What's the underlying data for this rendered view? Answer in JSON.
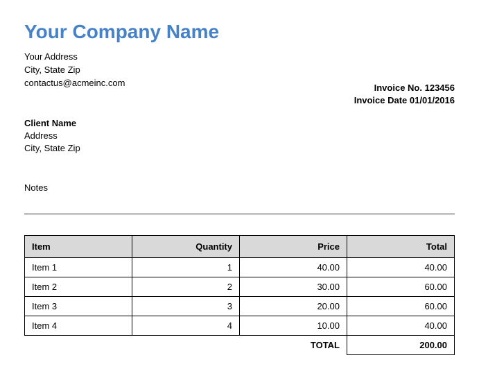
{
  "company": {
    "name": "Your Company Name",
    "address_line1": "Your Address",
    "address_line2": "City, State Zip",
    "email": "contactus@acmeinc.com"
  },
  "invoice": {
    "number_label": "Invoice No.",
    "number": "123456",
    "date_label": "Invoice Date",
    "date": "01/01/2016"
  },
  "client": {
    "name": "Client Name",
    "address_line1": "Address",
    "address_line2": "City, State Zip"
  },
  "notes_label": "Notes",
  "table": {
    "headers": {
      "item": "Item",
      "quantity": "Quantity",
      "price": "Price",
      "total": "Total"
    },
    "rows": [
      {
        "item": "Item 1",
        "quantity": "1",
        "price": "40.00",
        "total": "40.00"
      },
      {
        "item": "Item 2",
        "quantity": "2",
        "price": "30.00",
        "total": "60.00"
      },
      {
        "item": "Item 3",
        "quantity": "3",
        "price": "20.00",
        "total": "60.00"
      },
      {
        "item": "Item 4",
        "quantity": "4",
        "price": "10.00",
        "total": "40.00"
      }
    ],
    "total_label": "TOTAL",
    "total_value": "200.00"
  }
}
